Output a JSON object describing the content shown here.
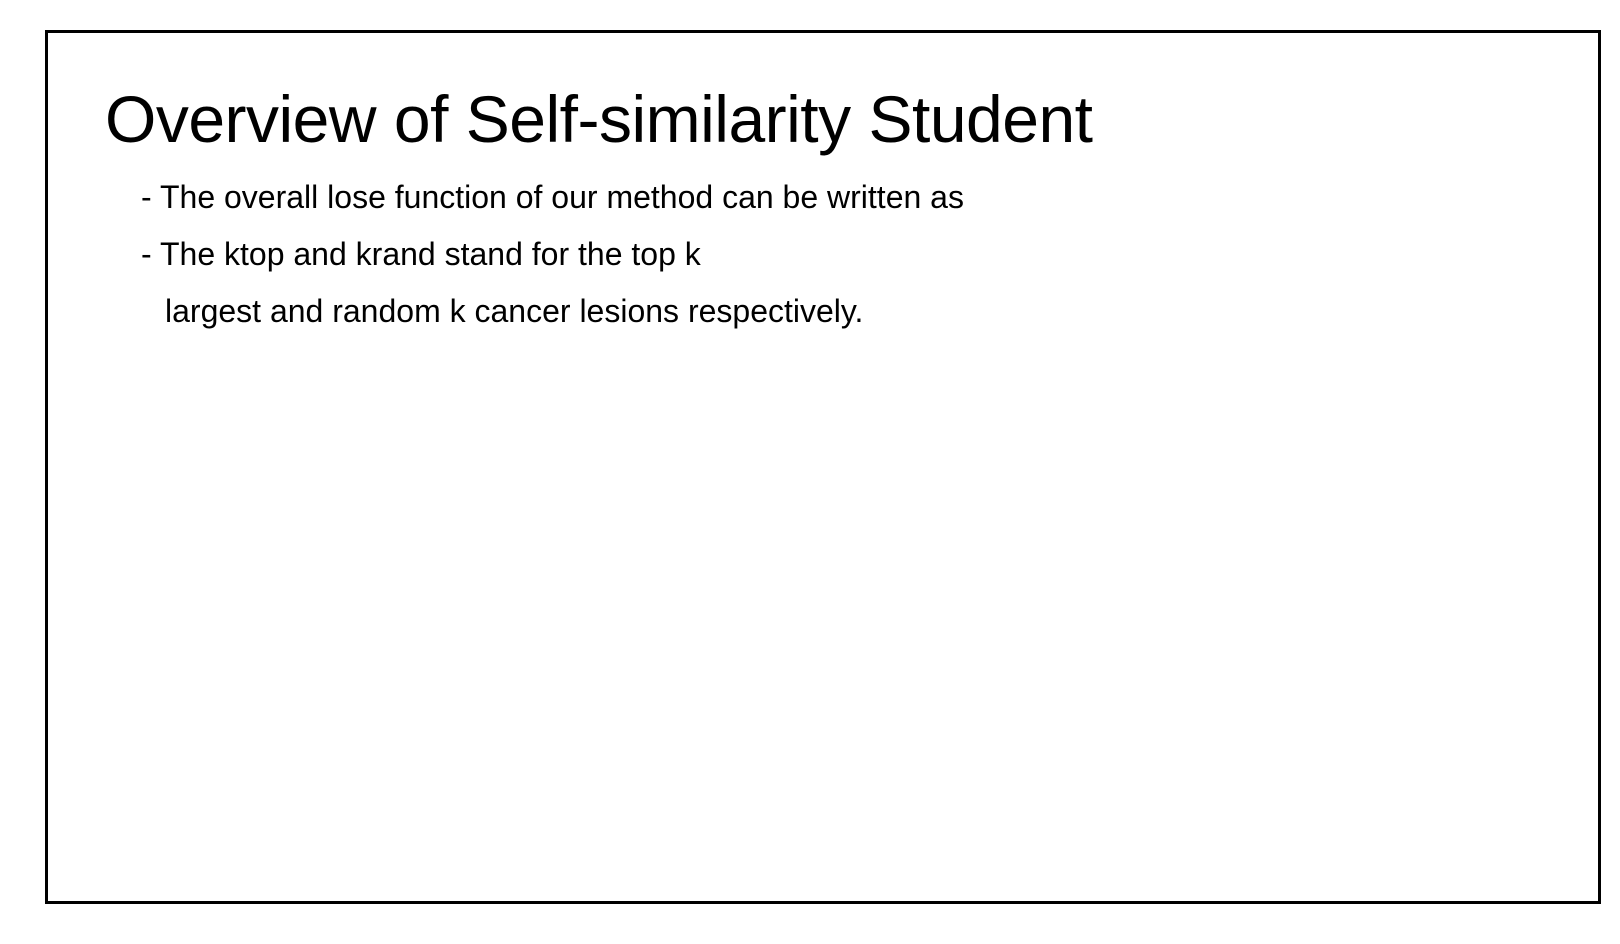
{
  "slide": {
    "title": "Overview of Self-similarity Student",
    "lines": [
      "- The overall lose function of our method can be written as",
      "- The ktop and krand stand for the top k",
      "largest and random k cancer lesions respectively."
    ]
  },
  "colors": {
    "background": "#ffffff",
    "border": "#000000",
    "text": "#000000"
  }
}
